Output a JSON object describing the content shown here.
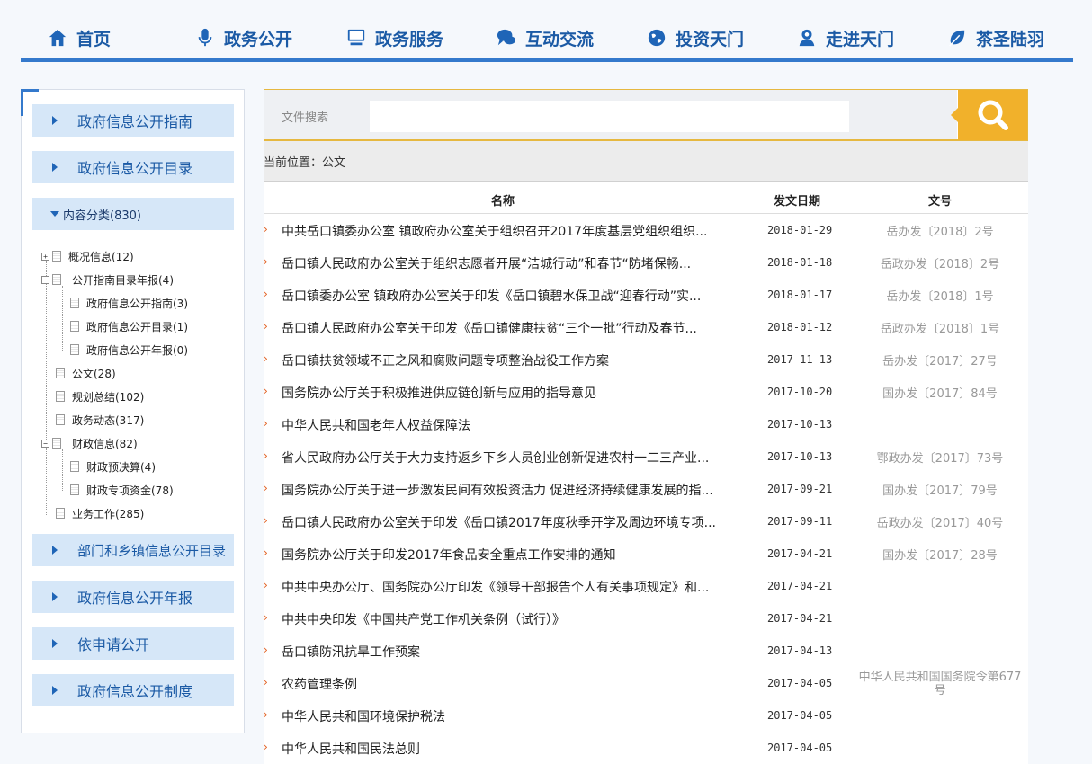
{
  "nav": {
    "items": [
      {
        "label": "首页",
        "icon": "home-icon"
      },
      {
        "label": "政务公开",
        "icon": "microphone-icon"
      },
      {
        "label": "政务服务",
        "icon": "monitor-icon"
      },
      {
        "label": "互动交流",
        "icon": "chat-icon"
      },
      {
        "label": "投资天门",
        "icon": "globe-icon"
      },
      {
        "label": "走进天门",
        "icon": "person-badge-icon"
      },
      {
        "label": "茶圣陆羽",
        "icon": "leaf-icon"
      }
    ],
    "accent": "#3479cc"
  },
  "sidebar": {
    "top_buttons": [
      "政府信息公开指南",
      "政府信息公开目录"
    ],
    "category": "内容分类(830)",
    "tree": [
      {
        "label": "概况信息(12)"
      },
      {
        "label": "公开指南目录年报(4)"
      },
      {
        "label": "政府信息公开指南(3)"
      },
      {
        "label": "政府信息公开目录(1)"
      },
      {
        "label": "政府信息公开年报(0)"
      },
      {
        "label": "公文(28)"
      },
      {
        "label": "规划总结(102)"
      },
      {
        "label": "政务动态(317)"
      },
      {
        "label": "财政信息(82)"
      },
      {
        "label": "财政预决算(4)"
      },
      {
        "label": "财政专项资金(78)"
      },
      {
        "label": "业务工作(285)"
      }
    ],
    "bottom_buttons": [
      "部门和乡镇信息公开目录",
      "政府信息公开年报",
      "依申请公开",
      "政府信息公开制度"
    ]
  },
  "search": {
    "label": "文件搜索",
    "value": "",
    "button_color": "#f1b12b"
  },
  "breadcrumb": "当前位置：公文",
  "table": {
    "headers": {
      "name": "名称",
      "date": "发文日期",
      "docno": "文号"
    },
    "rows": [
      {
        "title": "中共岳口镇委办公室 镇政府办公室关于组织召开2017年度基层党组织组织...",
        "date": "2018-01-29",
        "docno": "岳办发〔2018〕2号"
      },
      {
        "title": "岳口镇人民政府办公室关于组织志愿者开展“洁城行动”和春节“防堵保畅...",
        "date": "2018-01-18",
        "docno": "岳政办发〔2018〕2号"
      },
      {
        "title": "岳口镇委办公室 镇政府办公室关于印发《岳口镇碧水保卫战“迎春行动”实...",
        "date": "2018-01-17",
        "docno": "岳办发〔2018〕1号"
      },
      {
        "title": "岳口镇人民政府办公室关于印发《岳口镇健康扶贫“三个一批”行动及春节...",
        "date": "2018-01-12",
        "docno": "岳政办发〔2018〕1号"
      },
      {
        "title": "岳口镇扶贫领域不正之风和腐败问题专项整治战役工作方案",
        "date": "2017-11-13",
        "docno": "岳办发〔2017〕27号"
      },
      {
        "title": "国务院办公厅关于积极推进供应链创新与应用的指导意见",
        "date": "2017-10-20",
        "docno": "国办发〔2017〕84号"
      },
      {
        "title": "中华人民共和国老年人权益保障法",
        "date": "2017-10-13",
        "docno": ""
      },
      {
        "title": "省人民政府办公厅关于大力支持返乡下乡人员创业创新促进农村一二三产业...",
        "date": "2017-10-13",
        "docno": "鄂政办发〔2017〕73号"
      },
      {
        "title": "国务院办公厅关于进一步激发民间有效投资活力 促进经济持续健康发展的指...",
        "date": "2017-09-21",
        "docno": "国办发〔2017〕79号"
      },
      {
        "title": "岳口镇人民政府办公室关于印发《岳口镇2017年度秋季开学及周边环境专项...",
        "date": "2017-09-11",
        "docno": "岳政办发〔2017〕40号"
      },
      {
        "title": "国务院办公厅关于印发2017年食品安全重点工作安排的通知",
        "date": "2017-04-21",
        "docno": "国办发〔2017〕28号"
      },
      {
        "title": "中共中央办公厅、国务院办公厅印发《领导干部报告个人有关事项规定》和...",
        "date": "2017-04-21",
        "docno": ""
      },
      {
        "title": "中共中央印发《中国共产党工作机关条例（试行）》",
        "date": "2017-04-21",
        "docno": ""
      },
      {
        "title": "岳口镇防汛抗旱工作预案",
        "date": "2017-04-13",
        "docno": ""
      },
      {
        "title": "农药管理条例",
        "date": "2017-04-05",
        "docno": "中华人民共和国国务院令第677号",
        "docno_line1": "中华人民共和国国务院令第677",
        "docno_line2": "号"
      },
      {
        "title": "中华人民共和国环境保护税法",
        "date": "2017-04-05",
        "docno": ""
      },
      {
        "title": "中华人民共和国民法总则",
        "date": "2017-04-05",
        "docno": ""
      }
    ]
  }
}
